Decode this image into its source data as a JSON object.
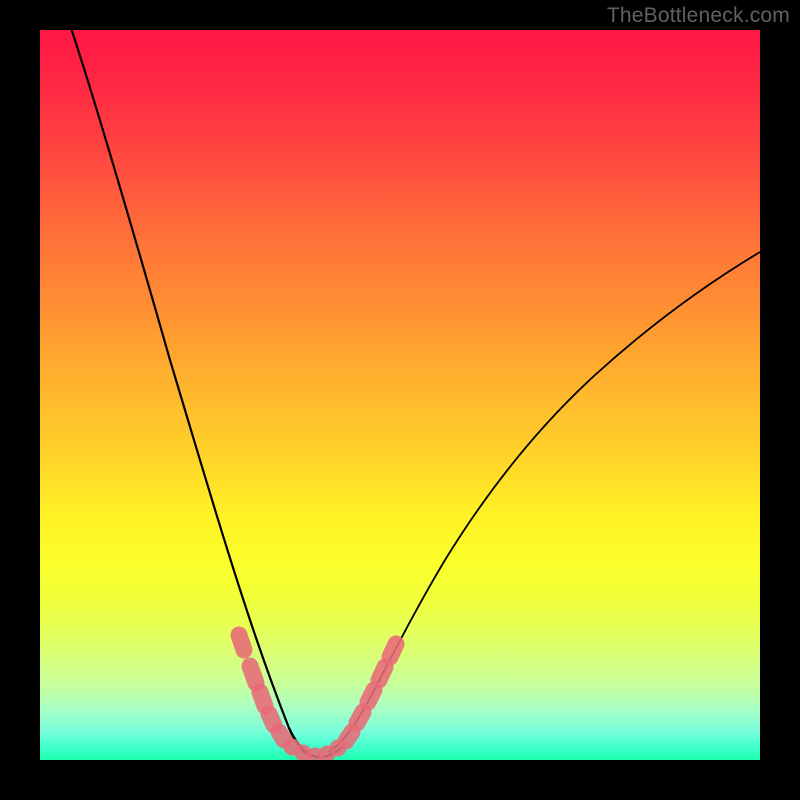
{
  "watermark": "TheBottleneck.com",
  "chart_data": {
    "type": "line",
    "title": "",
    "xlabel": "",
    "ylabel": "",
    "xlim": [
      0,
      100
    ],
    "ylim": [
      0,
      100
    ],
    "grid": false,
    "legend": false,
    "series": [
      {
        "name": "left-branch",
        "x": [
          4,
          7,
          10,
          13,
          16,
          19,
          22,
          24,
          26,
          28,
          29.5,
          31,
          32.3,
          33.5,
          34.5,
          35.3,
          36
        ],
        "values": [
          100,
          88,
          76,
          64,
          53,
          42.5,
          33,
          26,
          19.5,
          14,
          10.5,
          7.5,
          5.2,
          3.6,
          2.4,
          1.6,
          1.1
        ]
      },
      {
        "name": "right-branch",
        "x": [
          40,
          41,
          42.3,
          44,
          46,
          49,
          52,
          56,
          60,
          65,
          70,
          76,
          83,
          90,
          97,
          100
        ],
        "values": [
          1.2,
          1.8,
          2.8,
          4.4,
          7.0,
          11.3,
          15.8,
          21.5,
          26.8,
          32.7,
          37.8,
          43.2,
          48.6,
          53.1,
          57.0,
          58.6
        ]
      },
      {
        "name": "valley-floor",
        "x": [
          33,
          34.5,
          36,
          37.5,
          39,
          40.5,
          42
        ],
        "values": [
          2.1,
          1.4,
          1.0,
          0.9,
          1.0,
          1.4,
          2.2
        ]
      }
    ],
    "markers": {
      "name": "highlighted-points",
      "color": "#e86a78",
      "x": [
        27.5,
        29.5,
        30.5,
        31.3,
        32.2,
        33.2,
        34.2,
        35.0,
        35.9,
        37.0,
        38.2,
        39.3,
        40.3,
        41.2,
        42.2,
        43.3,
        44.5,
        45.7,
        46.9
      ],
      "values": [
        16.5,
        11.5,
        9.3,
        7.5,
        5.8,
        4.4,
        3.2,
        2.3,
        1.6,
        1.1,
        0.9,
        1.0,
        1.4,
        2.0,
        2.9,
        4.2,
        5.9,
        7.9,
        10.2
      ]
    },
    "gradient_stops": [
      {
        "pos": 0.0,
        "color": "#ff1744"
      },
      {
        "pos": 0.5,
        "color": "#ffd229"
      },
      {
        "pos": 0.75,
        "color": "#fbff29"
      },
      {
        "pos": 1.0,
        "color": "#1cffad"
      }
    ]
  }
}
